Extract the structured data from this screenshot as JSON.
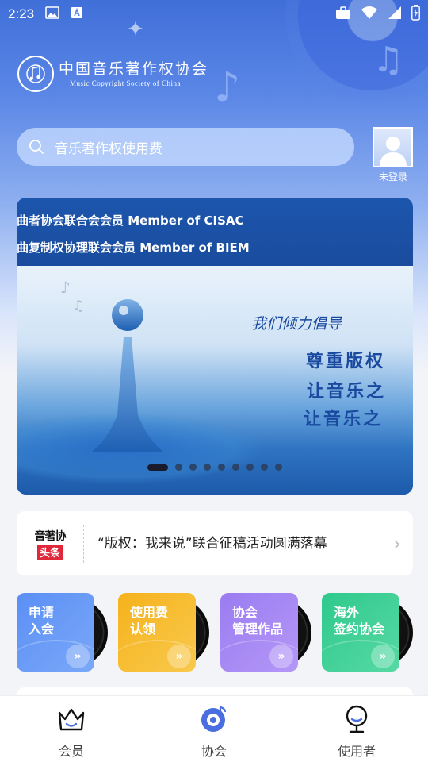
{
  "status_bar": {
    "time": "2:23",
    "icons_left": [
      "image-icon",
      "text-a-icon"
    ],
    "icons_right": [
      "briefcase-icon",
      "wifi-icon",
      "signal-icon",
      "battery-icon"
    ]
  },
  "header": {
    "logo_cn": "中国音乐著作权协会",
    "logo_en": "Music Copyright Society of China"
  },
  "search": {
    "placeholder": "音乐著作权使用费"
  },
  "user": {
    "login_status": "未登录"
  },
  "banner": {
    "line1": "曲者协会联合会会员 Member of CISAC",
    "line2": "曲复制权协理联会会员 Member of BIEM",
    "slogan1": "我们倾力倡导",
    "slogan2": "尊重版权",
    "slogan3": "让音乐之",
    "slogan4": "让音乐之",
    "dot_count": 9,
    "active_dot": 0
  },
  "news": {
    "badge_top": "音著协",
    "badge_bottom": "头条",
    "text": "“版权：我来说”联合征稿活动圆满落幕"
  },
  "quick_entries": [
    {
      "line1": "申请",
      "line2": "入会",
      "color_from": "#5b8ff5",
      "color_to": "#7aa8f8"
    },
    {
      "line1": "使用费",
      "line2": "认领",
      "color_from": "#f6b21c",
      "color_to": "#f8c94d"
    },
    {
      "line1": "协会",
      "line2": "管理作品",
      "color_from": "#9b7cf2",
      "color_to": "#b497f6"
    },
    {
      "line1": "海外",
      "line2": "签约协会",
      "color_from": "#2fc98c",
      "color_to": "#57d9a4"
    }
  ],
  "bottom_nav": [
    {
      "label": "会员",
      "icon": "crown-icon"
    },
    {
      "label": "协会",
      "icon": "music-disc-icon",
      "active": true
    },
    {
      "label": "使用者",
      "icon": "user-badge-icon"
    }
  ],
  "colors": {
    "primary": "#3f6fd8",
    "nav_accent": "#4a6ee0"
  }
}
